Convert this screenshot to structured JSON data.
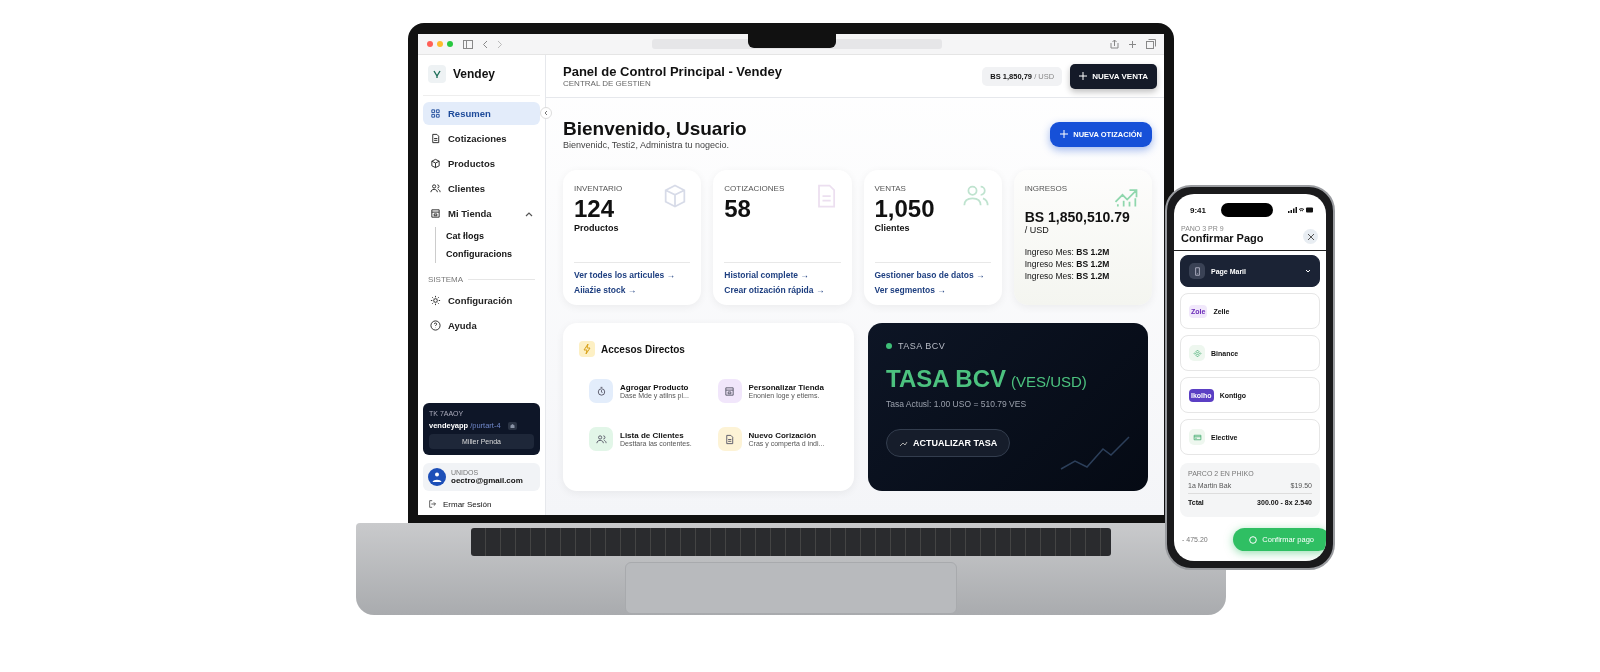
{
  "sidebar": {
    "brand": "Vendey",
    "items": [
      {
        "label": "Resumen",
        "selected": true
      },
      {
        "label": "Cotizaciones",
        "selected": false
      },
      {
        "label": "Productos",
        "selected": false
      },
      {
        "label": "Clientes",
        "selected": false
      },
      {
        "label": "Mi Tienda",
        "selected": false,
        "expanded": true,
        "children": [
          {
            "label": "Cat łlogs"
          },
          {
            "label": "Configuracions"
          }
        ]
      }
    ],
    "section": "SISTEMA",
    "system_items": [
      {
        "label": "Configuración",
        "selected": false
      },
      {
        "label": "Ayuda",
        "selected": false
      }
    ],
    "promo": {
      "label": "TK 7AAOY",
      "url": "vendeyapp",
      "path": "/purtart-4",
      "button": "Miller Penda"
    },
    "user": {
      "role": "UNIDOS",
      "email": "oectro@gmail.com"
    },
    "logout": "Ermar Sesión"
  },
  "header": {
    "title": "Panel de Control Principal - Vendey",
    "subtitle": "CENTRAL DE GESTIEN",
    "rate": "BS 1,850,79",
    "rate_unit": "/ USD",
    "button": "NUEVA VENTA"
  },
  "welcome": {
    "title": "Bienvenido, Usuario",
    "subtitle": "Bienvenidc, Testi2, Administra tu nogecio.",
    "button": "NUEVA OTIZACIÓN"
  },
  "stats": [
    {
      "kind": "count",
      "label": "INVENTARIO",
      "value": "124",
      "unit": "Productos",
      "links": [
        "Ver todes los articules →",
        "Aiiaźie stock →"
      ]
    },
    {
      "kind": "count",
      "label": "COTIZACIONES",
      "value": "58",
      "links": [
        "Historial complete →",
        "Crear otización rápida →"
      ]
    },
    {
      "kind": "count",
      "label": "VENTAS",
      "value": "1,050",
      "unit": "Clientes",
      "links": [
        "Gestioner baso de datos →",
        "Ver segmentos →"
      ]
    },
    {
      "kind": "revenue",
      "label": "INGRESOS",
      "value": "BS 1,850,510.79",
      "unit": "/ USD",
      "links": [
        "Ingreso Mes: **BS 1.2M**",
        "Ingreso Mes: **BS 1.2M**",
        "Ingreso Mes: **BS 1.2M**"
      ]
    }
  ],
  "shortcuts": {
    "title": "Accesos Directos",
    "items": [
      {
        "title": "Agrogar Producto",
        "desc": "Dase Mde y atilns pl...",
        "color": "#e3edfb"
      },
      {
        "title": "Personalizar Tienda",
        "desc": "Enonien loge y etiems.",
        "color": "#f1e6fb"
      },
      {
        "title": "Lista de Clientes",
        "desc": "Desttara las contentes.",
        "color": "#e2f6e8"
      },
      {
        "title": "Nuevo Corización",
        "desc": "Cras y comperta d indi...",
        "color": "#fdf3d6"
      }
    ]
  },
  "rate_card": {
    "label": "TASA BCV",
    "title": "TASA BCV",
    "unit": "(VES/USD)",
    "text": "Tasa Actusl: 1.00 USO = 510.79 VES",
    "button": "ACTUALIZAR TASA"
  },
  "phone": {
    "time": "9:41",
    "step": "PANO 3 PR 9",
    "title": "Confirmar Pago",
    "methods": [
      {
        "label": "Page Maril",
        "selected": true
      },
      {
        "label": "Zelle",
        "logo": "Zole",
        "selected": false
      },
      {
        "label": "Binance",
        "selected": false
      },
      {
        "label": "Kontigo",
        "logo": "Ikolho",
        "selected": false
      },
      {
        "label": "Elective",
        "selected": false
      }
    ],
    "summary": {
      "title": "PARCO 2 EN PHIKO",
      "line_label": "1a Martin Bak",
      "line_amount": "$19.50",
      "total_label": "Tctal",
      "total": "300.00 - 8x 2.540"
    },
    "footer_amount": "- 475.20",
    "button": "Confirmar pago"
  }
}
